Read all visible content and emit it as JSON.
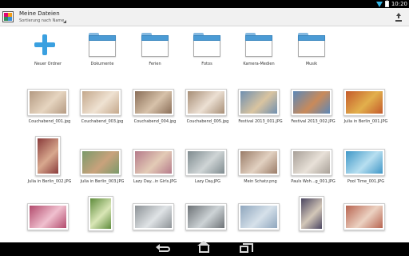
{
  "status_bar": {
    "time": "10:20"
  },
  "action_bar": {
    "title": "Meine Dateien",
    "subtitle": "Sortierung nach Name",
    "upload_icon": "upload-icon"
  },
  "folders": [
    {
      "label": "Neuer Ordner",
      "icon": "plus-icon"
    },
    {
      "label": "Dokumente",
      "icon": "folder-icon"
    },
    {
      "label": "Ferien",
      "icon": "folder-icon"
    },
    {
      "label": "Fotos",
      "icon": "folder-icon"
    },
    {
      "label": "Kamera-Medien",
      "icon": "folder-icon"
    },
    {
      "label": "Musik",
      "icon": "folder-icon"
    }
  ],
  "photos": [
    {
      "label": "Couchabend_001.jpg",
      "orientation": "landscape",
      "colors": [
        "#b49a82",
        "#e6d5c0"
      ]
    },
    {
      "label": "Couchabend_003.jpg",
      "orientation": "landscape",
      "colors": [
        "#c4a88c",
        "#efe2d2"
      ]
    },
    {
      "label": "Couchabend_004.jpg",
      "orientation": "landscape",
      "colors": [
        "#8a6e58",
        "#d7c2aa"
      ]
    },
    {
      "label": "Couchabend_005.jpg",
      "orientation": "landscape",
      "colors": [
        "#a78e76",
        "#ece0d3"
      ]
    },
    {
      "label": "Festival 2013_001.JPG",
      "orientation": "landscape",
      "colors": [
        "#6f8fb0",
        "#d9c4a0"
      ]
    },
    {
      "label": "Festival 2013_002.JPG",
      "orientation": "landscape",
      "colors": [
        "#5b88b8",
        "#c98a5a"
      ]
    },
    {
      "label": "Julia in Berlin_001.JPG",
      "orientation": "landscape",
      "colors": [
        "#c45a2b",
        "#e2b04c"
      ]
    },
    {
      "label": "Julia in Berlin_002.JPG",
      "orientation": "portrait",
      "colors": [
        "#8a3b3b",
        "#d8a88e"
      ]
    },
    {
      "label": "Julia in Berlin_003.JPG",
      "orientation": "landscape",
      "colors": [
        "#7a9a6a",
        "#c9a27c"
      ]
    },
    {
      "label": "Lazy Day...in Girls.JPG",
      "orientation": "landscape",
      "colors": [
        "#b57a8a",
        "#e3cbb6"
      ]
    },
    {
      "label": "Lazy Day.JPG",
      "orientation": "landscape",
      "colors": [
        "#7f8b8f",
        "#cfd5d6"
      ]
    },
    {
      "label": "Mein Schatz.png",
      "orientation": "landscape",
      "colors": [
        "#9a7c68",
        "#e2d1c1"
      ]
    },
    {
      "label": "Pauls Woh...g_001.JPG",
      "orientation": "landscape",
      "colors": [
        "#a8a098",
        "#e8e1d8"
      ]
    },
    {
      "label": "Pool Time_001.JPG",
      "orientation": "landscape",
      "colors": [
        "#3f97c7",
        "#b7dff0"
      ]
    },
    {
      "label": "",
      "orientation": "landscape",
      "colors": [
        "#b24a6c",
        "#f0c0cf"
      ]
    },
    {
      "label": "",
      "orientation": "portrait",
      "colors": [
        "#5e8b3b",
        "#d9e6b6"
      ]
    },
    {
      "label": "",
      "orientation": "landscape",
      "colors": [
        "#8d9296",
        "#dfe3e6"
      ]
    },
    {
      "label": "",
      "orientation": "landscape",
      "colors": [
        "#6d7276",
        "#cdd3d6"
      ]
    },
    {
      "label": "",
      "orientation": "landscape",
      "colors": [
        "#8fa6bd",
        "#d6e1ea"
      ]
    },
    {
      "label": "",
      "orientation": "portrait",
      "colors": [
        "#4a4560",
        "#d3c7b8"
      ]
    },
    {
      "label": "",
      "orientation": "landscape",
      "colors": [
        "#b7634f",
        "#ecd2c2"
      ]
    }
  ],
  "nav_bar": {
    "back": "back-icon",
    "home": "home-icon",
    "recents": "recents-icon"
  }
}
